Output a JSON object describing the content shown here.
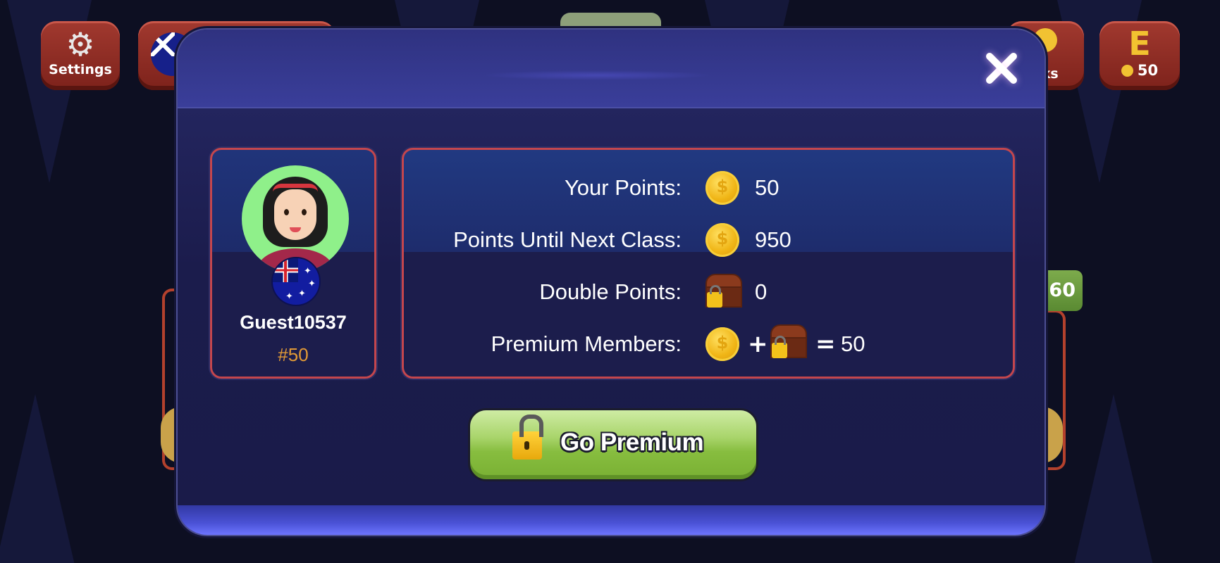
{
  "topbar": {
    "settings_label": "Settings",
    "ranks_label": "nks",
    "level_letter": "E",
    "level_points": "50"
  },
  "side": {
    "green_value": "60"
  },
  "profile": {
    "username": "Guest10537",
    "rank": "#50"
  },
  "stats": {
    "your_points": {
      "label": "Your Points:",
      "value": "50"
    },
    "next_class": {
      "label": "Points Until Next Class:",
      "value": "950"
    },
    "double_points": {
      "label": "Double Points:",
      "value": "0"
    },
    "premium_members": {
      "label": "Premium Members:",
      "plus": "+",
      "equals": "=",
      "value": "50"
    }
  },
  "buttons": {
    "go_premium": "Go Premium"
  },
  "colors": {
    "modal_bg": "#1c1d4c",
    "card_border": "#c4464d",
    "premium_green": "#87bd3f",
    "rank_orange": "#e29a36",
    "coin_gold": "#f0b516"
  },
  "icons": [
    "gear-icon",
    "flag-icon",
    "medal-icon",
    "coin-icon",
    "chest-icon",
    "close-icon",
    "padlock-icon"
  ]
}
